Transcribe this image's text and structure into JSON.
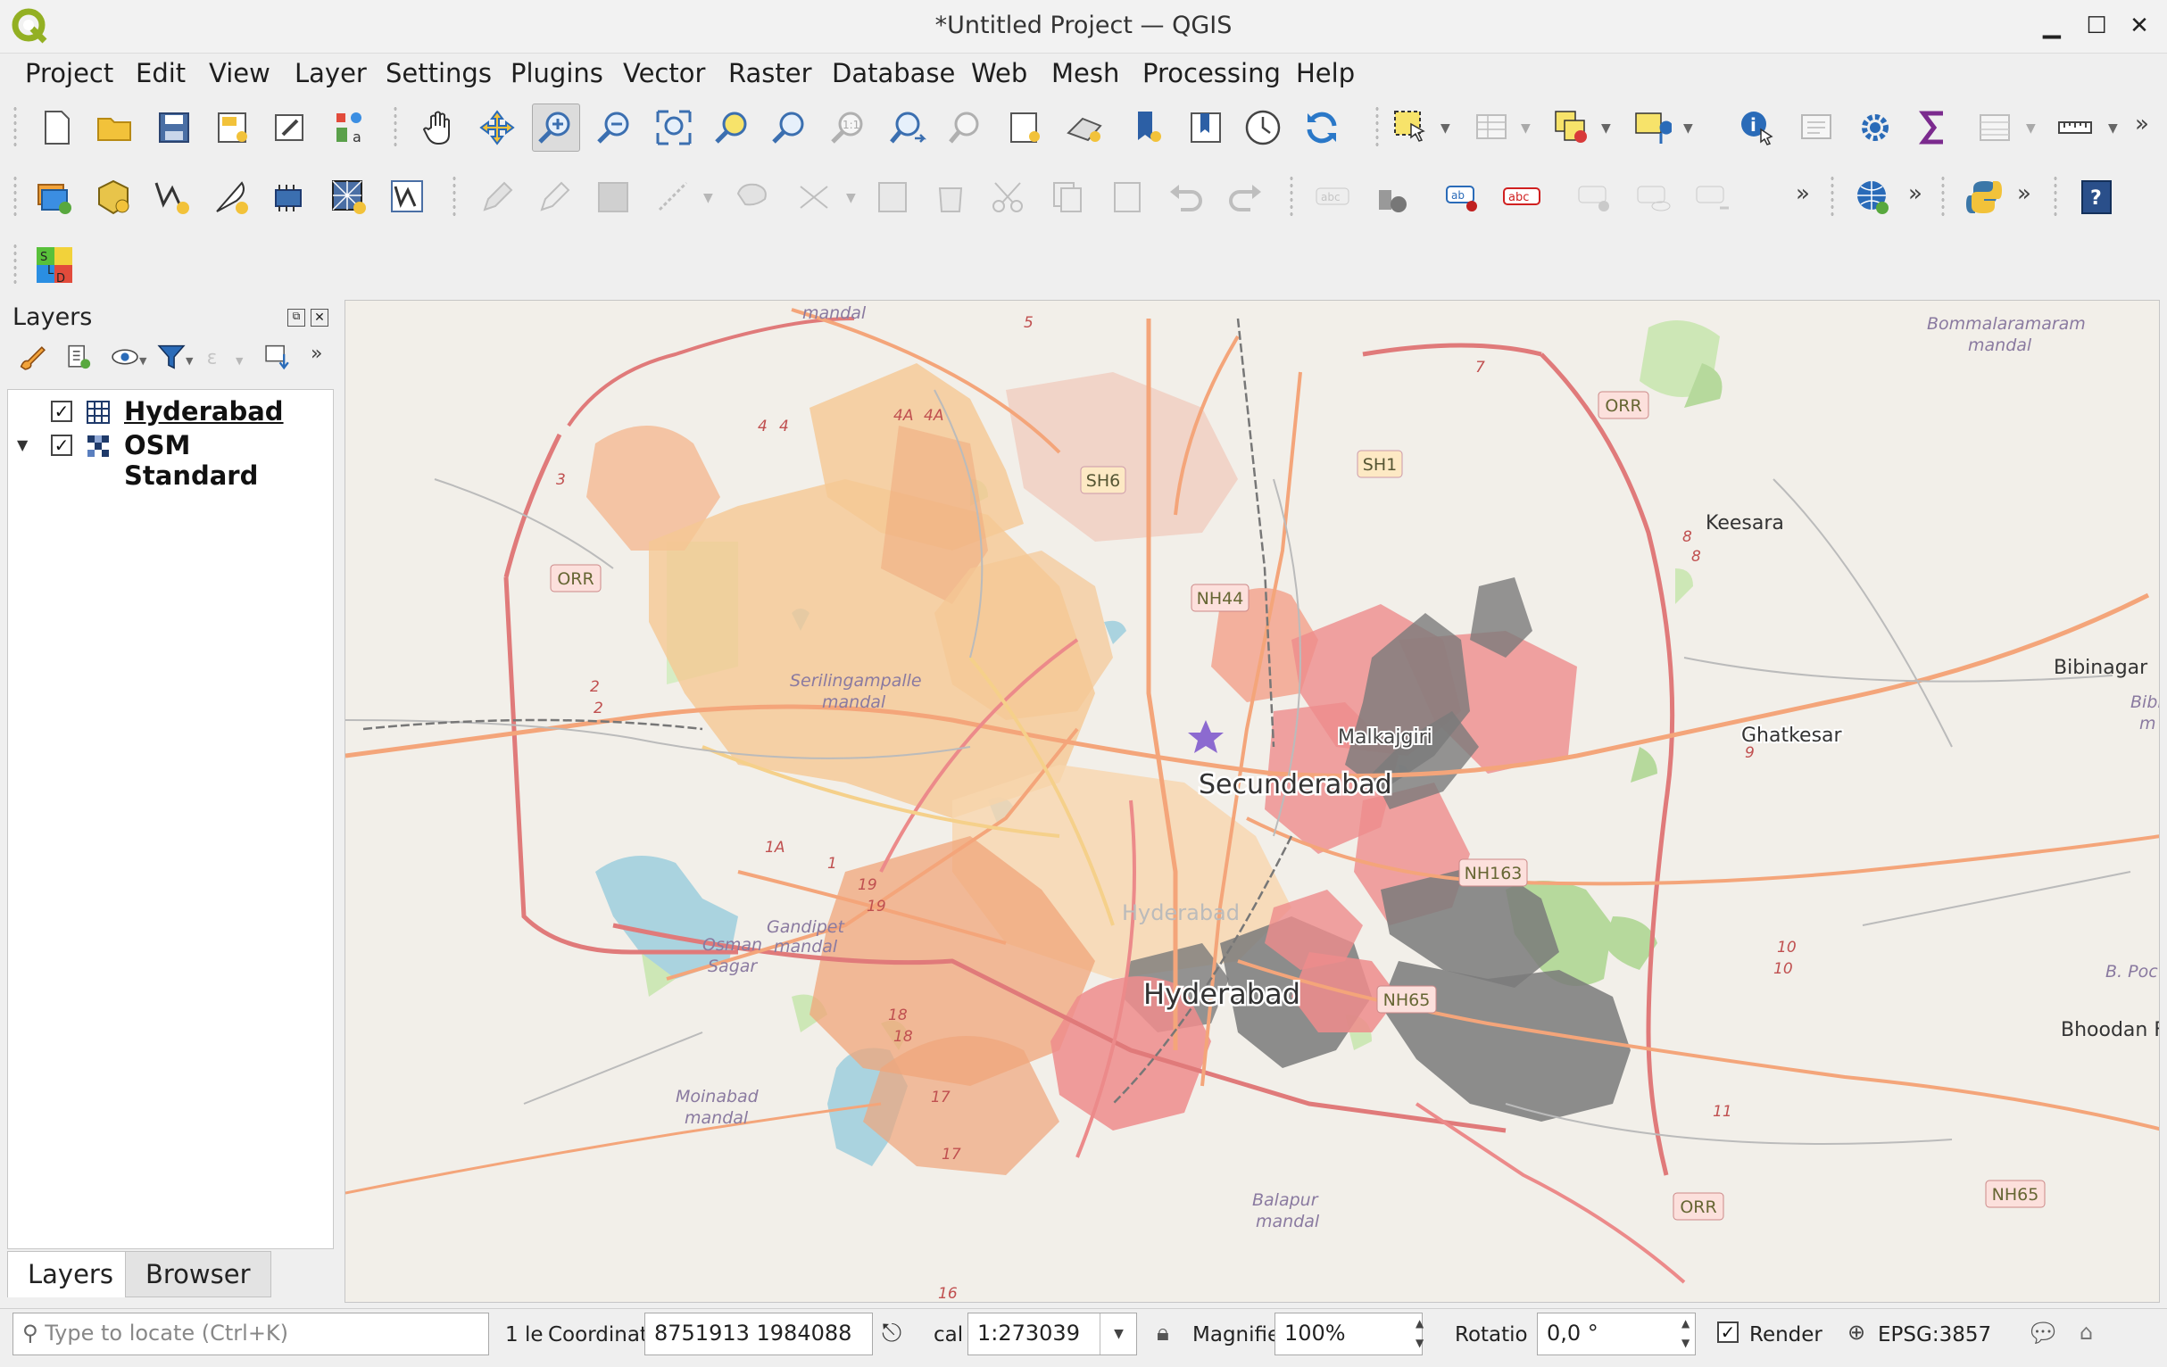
{
  "window": {
    "title": "*Untitled Project — QGIS"
  },
  "menu": [
    "Project",
    "Edit",
    "View",
    "Layer",
    "Settings",
    "Plugins",
    "Vector",
    "Raster",
    "Database",
    "Web",
    "Mesh",
    "Processing",
    "Help"
  ],
  "layers_panel": {
    "title": "Layers",
    "layers": [
      {
        "name": "Hyderabad",
        "checked": true,
        "icon": "table-grid-icon",
        "expandable": false
      },
      {
        "name": "OSM Standard",
        "checked": true,
        "icon": "raster-tile-icon",
        "expandable": true
      }
    ],
    "tabs": [
      "Layers",
      "Browser"
    ]
  },
  "map": {
    "labels": {
      "secunderabad": "Secunderabad",
      "hyderabad_big": "Hyderabad",
      "hyderabad_faint": "Hyderabad",
      "malkajgiri": "Malkajgiri",
      "keesara": "Keesara",
      "ghatkesar": "Ghatkesar",
      "bibinagar": "Bibinagar",
      "bhoodan": "Bhoodan F",
      "serilingampalle": "Serilingampalle",
      "serilingampalle_mandal": "mandal",
      "gandipet": "Gandipet",
      "gandipet_mandal": "mandal",
      "osman": "Osman",
      "sagar": "Sagar",
      "moinabad": "Moinabad",
      "moinabad_mandal": "mandal",
      "balapur": "Balapur",
      "balapur_mandal": "mandal",
      "bommalaramaram": "Bommalaramaram",
      "bommalaramaram_mandal": "mandal",
      "top_mandal": "mandal",
      "bpoc": "B. Poc",
      "bibi_r": "Bibi",
      "bibi_r2": "m"
    },
    "shields": {
      "orr_w": "ORR",
      "orr_ne": "ORR",
      "orr_se": "ORR",
      "sh6": "SH6",
      "sh1": "SH1",
      "nh44": "NH44",
      "nh163": "NH163",
      "nh65_c": "NH65",
      "nh65_e": "NH65"
    },
    "road_numbers": [
      "5",
      "7",
      "3",
      "4A",
      "4A",
      "4",
      "4",
      "8",
      "8",
      "2",
      "2",
      "9",
      "10",
      "10",
      "11",
      "1A",
      "1",
      "19",
      "19",
      "18",
      "18",
      "17",
      "17",
      "16"
    ]
  },
  "status": {
    "locator_placeholder": "Type to locate (Ctrl+K)",
    "legend_msg": "1 le",
    "coordinate_label": "Coordinat",
    "coordinate_value": "8751913  1984088",
    "scale_label": "cal",
    "scale_value": "1:273039",
    "magnifier_label": "Magnifie",
    "magnifier_value": "100%",
    "rotation_label": "Rotatio",
    "rotation_value": "0,0 °",
    "render_label": "Render",
    "render_checked": true,
    "crs": "EPSG:3857"
  }
}
